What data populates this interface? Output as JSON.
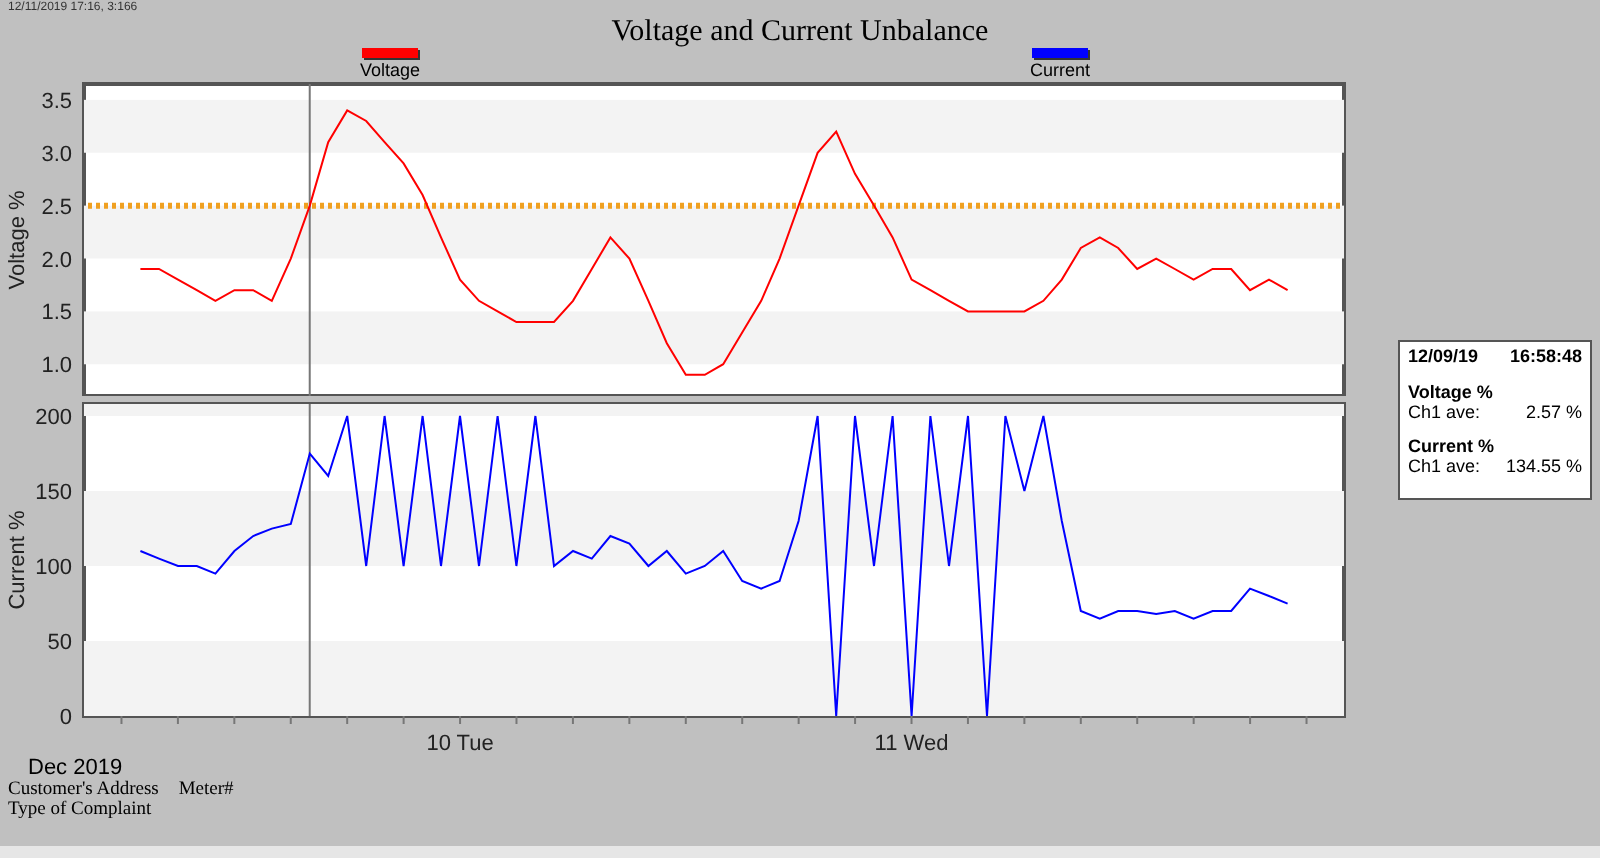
{
  "window": {
    "timestamp": "12/11/2019 17:16, 3:166",
    "title": "Voltage and Current Unbalance"
  },
  "charts": [
    {
      "chart_data": {
        "type": "line",
        "ylabel": "Voltage %",
        "xlim": [
          9.167,
          11.958
        ],
        "ylim": [
          0.7,
          3.65
        ],
        "yticks": [
          {
            "value": 1,
            "label": "1.0"
          },
          {
            "value": 1.5,
            "label": "1.5"
          },
          {
            "value": 2,
            "label": "2.0"
          },
          {
            "value": 2.5,
            "label": "2.5"
          },
          {
            "value": 3,
            "label": "3.0"
          },
          {
            "value": 3.5,
            "label": "3.5"
          }
        ],
        "x": [
          9.292,
          9.333,
          9.375,
          9.417,
          9.458,
          9.5,
          9.542,
          9.583,
          9.625,
          9.667,
          9.708,
          9.75,
          9.792,
          9.833,
          9.875,
          9.917,
          9.958,
          10,
          10.042,
          10.083,
          10.125,
          10.167,
          10.208,
          10.25,
          10.292,
          10.333,
          10.375,
          10.417,
          10.458,
          10.5,
          10.542,
          10.583,
          10.625,
          10.667,
          10.708,
          10.75,
          10.792,
          10.833,
          10.875,
          10.917,
          10.958,
          11,
          11.042,
          11.083,
          11.125,
          11.167,
          11.208,
          11.25,
          11.292,
          11.333,
          11.375,
          11.417,
          11.458,
          11.5,
          11.542,
          11.583,
          11.625,
          11.667,
          11.708,
          11.75,
          11.792,
          11.833
        ],
        "series": [
          {
            "name": "Voltage",
            "color": "#ff0000",
            "values": [
              1.9,
              1.9,
              1.8,
              1.7,
              1.6,
              1.7,
              1.7,
              1.6,
              2.0,
              2.5,
              3.1,
              3.4,
              3.3,
              3.1,
              2.9,
              2.6,
              2.2,
              1.8,
              1.6,
              1.5,
              1.4,
              1.4,
              1.4,
              1.6,
              1.9,
              2.2,
              2.0,
              1.6,
              1.2,
              0.9,
              0.9,
              1.0,
              1.3,
              1.6,
              2.0,
              2.5,
              3.0,
              3.2,
              2.8,
              2.5,
              2.2,
              1.8,
              1.7,
              1.6,
              1.5,
              1.5,
              1.5,
              1.5,
              1.6,
              1.8,
              2.1,
              2.2,
              2.1,
              1.9,
              2.0,
              1.9,
              1.8,
              1.9,
              1.9,
              1.7,
              1.8,
              1.7
            ]
          }
        ],
        "ref_lines": [
          {
            "axis": "y",
            "value": 2.5
          },
          {
            "axis": "x",
            "value": 9.667
          }
        ]
      }
    },
    {
      "chart_data": {
        "type": "line",
        "ylabel": "Current %",
        "xlim": [
          9.167,
          11.958
        ],
        "ylim": [
          0,
          208
        ],
        "yticks": [
          0,
          50,
          100,
          150,
          200
        ],
        "xticks": [
          {
            "value": 10,
            "label": "10 Tue"
          },
          {
            "value": 11,
            "label": "11 Wed"
          }
        ],
        "x": [
          9.292,
          9.333,
          9.375,
          9.417,
          9.458,
          9.5,
          9.542,
          9.583,
          9.625,
          9.667,
          9.708,
          9.75,
          9.792,
          9.833,
          9.875,
          9.917,
          9.958,
          10,
          10.042,
          10.083,
          10.125,
          10.167,
          10.208,
          10.25,
          10.292,
          10.333,
          10.375,
          10.417,
          10.458,
          10.5,
          10.542,
          10.583,
          10.625,
          10.667,
          10.708,
          10.75,
          10.792,
          10.833,
          10.875,
          10.917,
          10.958,
          11,
          11.042,
          11.083,
          11.125,
          11.167,
          11.208,
          11.25,
          11.292,
          11.333,
          11.375,
          11.417,
          11.458,
          11.5,
          11.542,
          11.583,
          11.625,
          11.667,
          11.708,
          11.75,
          11.792,
          11.833
        ],
        "series": [
          {
            "name": "Current",
            "color": "#0000ff",
            "values": [
              110,
              105,
              100,
              100,
              95,
              110,
              120,
              125,
              128,
              175,
              160,
              200,
              100,
              200,
              100,
              200,
              100,
              200,
              100,
              200,
              100,
              200,
              100,
              110,
              105,
              120,
              115,
              100,
              110,
              95,
              100,
              110,
              90,
              85,
              90,
              130,
              200,
              0,
              200,
              100,
              200,
              0,
              200,
              100,
              200,
              0,
              200,
              150,
              200,
              130,
              70,
              65,
              70,
              70,
              68,
              70,
              65,
              70,
              70,
              85,
              80,
              75
            ]
          }
        ],
        "ref_lines": [
          {
            "axis": "x",
            "value": 9.667
          }
        ]
      }
    }
  ],
  "month": "Dec 2019",
  "readout": {
    "date": "12/09/19",
    "time": "16:58:48",
    "sections": [
      {
        "title": "Voltage %",
        "label": "Ch1 ave:",
        "value": "2.57 %"
      },
      {
        "title": "Current %",
        "label": "Ch1 ave:",
        "value": "134.55 %"
      }
    ]
  },
  "footer": {
    "lines": [
      [
        "Customer's Address",
        "Meter#"
      ],
      [
        "Type of Complaint"
      ]
    ]
  }
}
